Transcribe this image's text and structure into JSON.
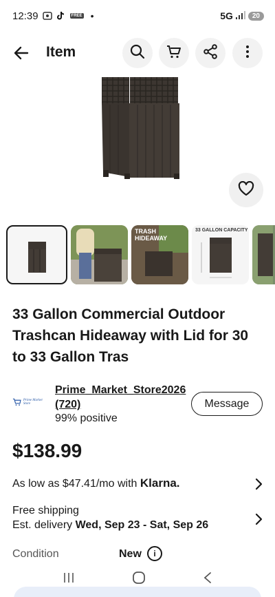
{
  "status_bar": {
    "time": "12:39",
    "free_badge": "FREE",
    "network": "5G",
    "battery": "20"
  },
  "header": {
    "title": "Item"
  },
  "hero": {
    "alt": "Trashcan Hideaway product image"
  },
  "thumbnails": [
    {
      "caption": ""
    },
    {
      "caption": ""
    },
    {
      "caption": "TRASH HIDEAWAY"
    },
    {
      "caption": "33 GALLON CAPACITY"
    },
    {
      "caption": ""
    }
  ],
  "product": {
    "title": "33 Gallon Commercial Outdoor Trashcan Hideaway with Lid for 30 to 33 Gallon Tras",
    "price": "$138.99"
  },
  "seller": {
    "name": "Prime_Market_Store2026",
    "feedback_count": "(720)",
    "positive": "99% positive",
    "message_label": "Message",
    "logo_text": "Prime Market Store"
  },
  "financing": {
    "prefix": "As low as $47.41/mo with ",
    "brand": "Klarna."
  },
  "shipping": {
    "line1": "Free shipping",
    "est_prefix": "Est. delivery ",
    "dates": "Wed, Sep 23 - Sat, Sep 26"
  },
  "condition": {
    "label": "Condition",
    "value": "New",
    "info": "i"
  }
}
